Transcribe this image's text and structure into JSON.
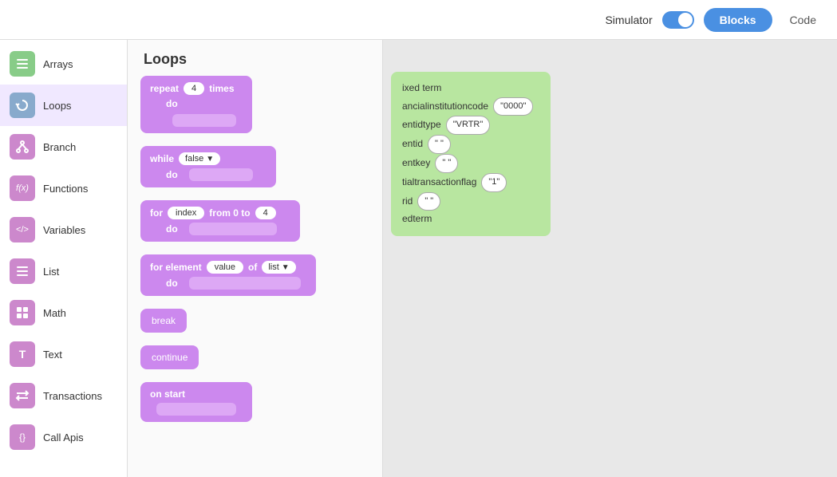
{
  "header": {
    "simulator_label": "Simulator",
    "blocks_label": "Blocks",
    "code_label": "Code"
  },
  "sidebar": {
    "items": [
      {
        "id": "arrays",
        "label": "Arrays",
        "icon": "☰",
        "color": "#88cc88"
      },
      {
        "id": "loops",
        "label": "Loops",
        "icon": "↺",
        "color": "#88aacc",
        "active": true
      },
      {
        "id": "branch",
        "label": "Branch",
        "icon": "⑂",
        "color": "#cc88cc"
      },
      {
        "id": "functions",
        "label": "Functions",
        "icon": "f(x)",
        "color": "#cc88cc"
      },
      {
        "id": "variables",
        "label": "Variables",
        "icon": "</>",
        "color": "#cc88cc"
      },
      {
        "id": "list",
        "label": "List",
        "icon": "≡",
        "color": "#cc88cc"
      },
      {
        "id": "math",
        "label": "Math",
        "icon": "⊞",
        "color": "#cc88cc"
      },
      {
        "id": "text",
        "label": "Text",
        "icon": "T",
        "color": "#cc88cc"
      },
      {
        "id": "transactions",
        "label": "Transactions",
        "icon": "⇄",
        "color": "#cc88cc"
      },
      {
        "id": "call-api",
        "label": "Call Apis",
        "icon": "{}",
        "color": "#cc88cc"
      }
    ]
  },
  "blocks_panel": {
    "title": "Loops",
    "blocks": [
      {
        "type": "repeat",
        "keyword1": "repeat",
        "times_value": "4",
        "keyword2": "times",
        "do_keyword": "do"
      },
      {
        "type": "while",
        "keyword1": "while",
        "condition": "false",
        "do_keyword": "do"
      },
      {
        "type": "for_index",
        "keyword1": "for",
        "var_name": "index",
        "from_text": "from 0 to",
        "to_value": "4",
        "do_keyword": "do"
      },
      {
        "type": "for_element",
        "keyword1": "for element",
        "var_name": "value",
        "of_text": "of",
        "list_name": "list",
        "do_keyword": "do"
      },
      {
        "type": "break",
        "keyword": "break"
      },
      {
        "type": "continue",
        "keyword": "continue"
      },
      {
        "type": "on_start",
        "keyword": "on start"
      }
    ]
  },
  "canvas": {
    "card_text": "ixed term\nancialinstitutioncode\nentidtype\nentid\nentkey\ntialtransactionflag\nrid\nedterm",
    "fields": [
      {
        "label": "ixed term",
        "value": null
      },
      {
        "label": "ancialinstitutioncode",
        "value": "\"0000\""
      },
      {
        "label": "entidtype",
        "value": "\"VRTR\""
      },
      {
        "label": "entid",
        "value": "\" \""
      },
      {
        "label": "entkey",
        "value": "\" \""
      },
      {
        "label": "tialtransactionflag",
        "value": "\"1\""
      },
      {
        "label": "rid",
        "value": "\" \""
      },
      {
        "label": "edterm",
        "value": null
      }
    ]
  }
}
